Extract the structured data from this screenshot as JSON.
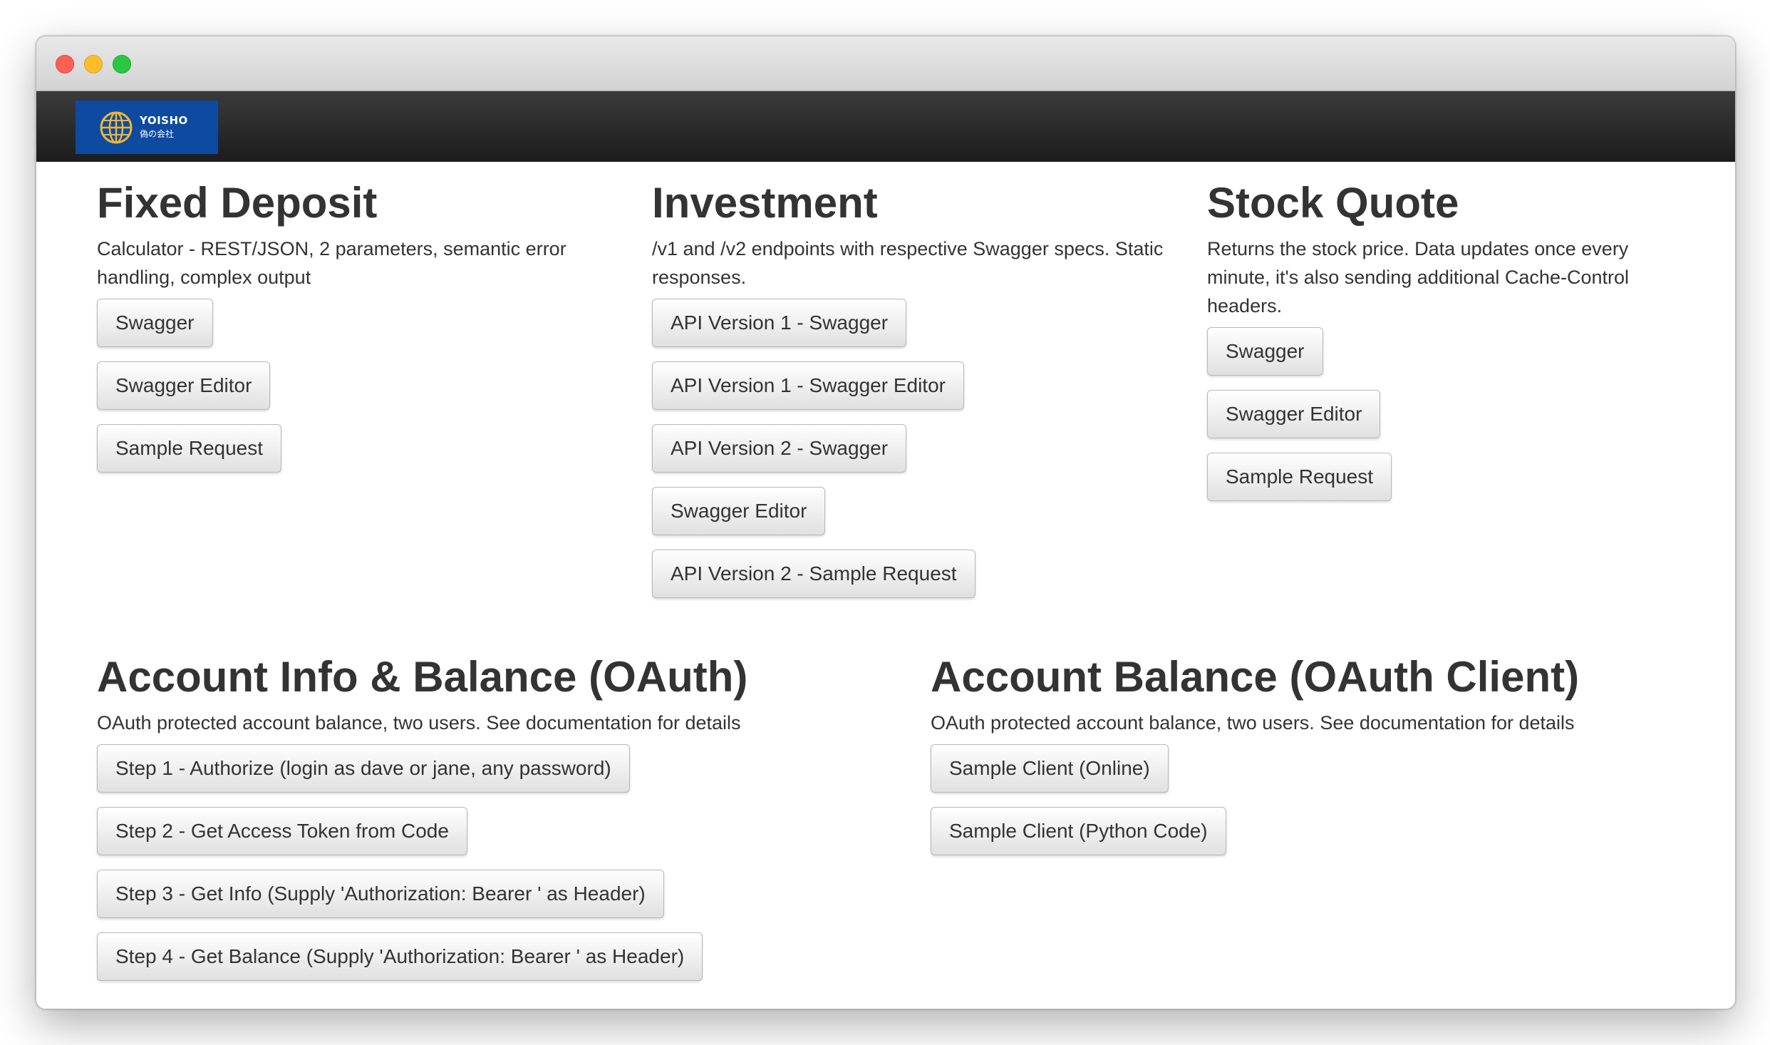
{
  "brand": {
    "name": "YOISHO",
    "subtitle": "偽の会社"
  },
  "fixed_deposit": {
    "title": "Fixed Deposit",
    "description": "Calculator - REST/JSON, 2 parameters, semantic error handling, complex output",
    "buttons": [
      "Swagger",
      "Swagger Editor",
      "Sample Request"
    ]
  },
  "investment": {
    "title": "Investment",
    "description": "/v1 and /v2 endpoints with respective Swagger specs. Static responses.",
    "buttons": [
      "API Version 1 - Swagger",
      "API Version 1 - Swagger Editor",
      "API Version 2 - Swagger",
      "Swagger Editor",
      "API Version 2 - Sample Request"
    ]
  },
  "stock_quote": {
    "title": "Stock Quote",
    "description": "Returns the stock price. Data updates once every minute, it's also sending additional Cache-Control headers.",
    "buttons": [
      "Swagger",
      "Swagger Editor",
      "Sample Request"
    ]
  },
  "account_info": {
    "title": "Account Info & Balance (OAuth)",
    "description": "OAuth protected account balance, two users. See documentation for details",
    "buttons": [
      "Step 1 - Authorize (login as dave or jane, any password)",
      "Step 2 - Get Access Token from Code",
      "Step 3 - Get Info (Supply 'Authorization: Bearer ' as Header)",
      "Step 4 - Get Balance (Supply 'Authorization: Bearer ' as Header)"
    ]
  },
  "account_balance": {
    "title": "Account Balance (OAuth Client)",
    "description": "OAuth protected account balance, two users. See documentation for details",
    "buttons": [
      "Sample Client (Online)",
      "Sample Client (Python Code)"
    ]
  },
  "colors": {
    "logo_background": "#0d4aa0",
    "navbar": "#222222",
    "text": "#333333"
  }
}
